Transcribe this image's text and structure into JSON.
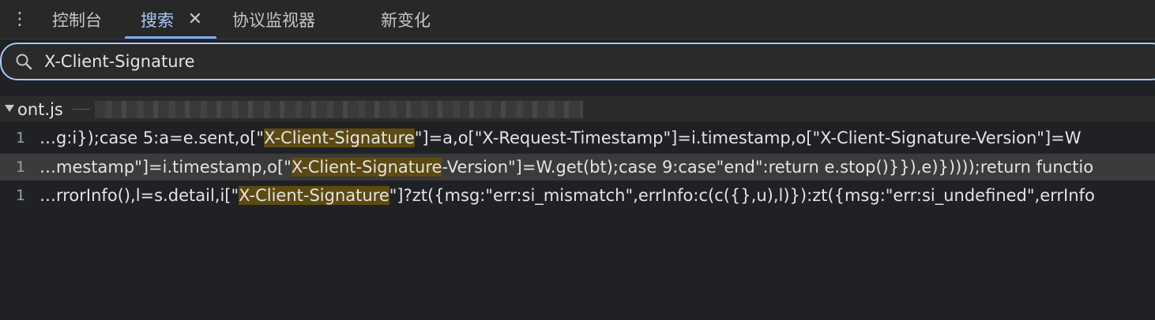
{
  "tabs": [
    {
      "label": "控制台"
    },
    {
      "label": "搜索",
      "active": true
    },
    {
      "label": "协议监视器"
    },
    {
      "label": "新变化"
    }
  ],
  "search": {
    "query": "X-Client-Signature"
  },
  "file": {
    "name": "ont.js"
  },
  "results": [
    {
      "line": "1",
      "before": "…g:i});case 5:a=e.sent,o[\"",
      "match": "X-Client-Signature",
      "after": "\"]=a,o[\"X-Request-Timestamp\"]=i.timestamp,o[\"X-Client-Signature-Version\"]=W"
    },
    {
      "line": "1",
      "before": "…mestamp\"]=i.timestamp,o[\"",
      "match": "X-Client-Signature",
      "after": "-Version\"]=W.get(bt);case 9:case\"end\":return e.stop()}}),e)}))));return functio"
    },
    {
      "line": "1",
      "before": "…rrorInfo(),l=s.detail,i[\"",
      "match": "X-Client-Signature",
      "after": "\"]?zt({msg:\"err:si_mismatch\",errInfo:c(c({},u),l)}):zt({msg:\"err:si_undefined\",errInfo"
    }
  ],
  "colors": {
    "accent": "#a8c7fa",
    "highlight": "#5c4a12",
    "background": "#202124"
  }
}
